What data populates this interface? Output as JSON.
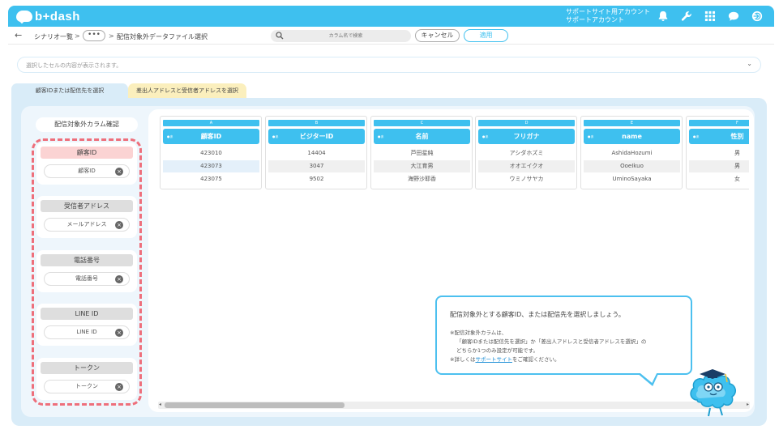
{
  "header": {
    "logo_text": "b+dash",
    "account_line1": "サポートサイト用アカウント",
    "account_line2": "サポートアカウント",
    "icons": [
      "bell-icon",
      "wrench-icon",
      "grid-icon",
      "chat-icon",
      "logout-icon"
    ],
    "bg_color": "#3ec0ef"
  },
  "breadcrumb": {
    "back": "←",
    "item1": "シナリオ一覧",
    "sep": ">",
    "more": "•••",
    "item2": "配信対象外データファイル選択"
  },
  "toolbar": {
    "search_placeholder": "カラム名で検索",
    "cancel_label": "キャンセル",
    "apply_label": "適用"
  },
  "cell_bar": {
    "placeholder": "選択したセルの内容が表示されます。"
  },
  "tabs": [
    {
      "label": "顧客IDまたは配信先を選択",
      "active": true
    },
    {
      "label": "差出人アドレスと受信者アドレスを選択",
      "active": false
    }
  ],
  "left_panel": {
    "title": "配信対象外カラム確認",
    "cards": [
      {
        "label": "顧客ID",
        "chip": "顧客ID"
      },
      {
        "label": "受信者アドレス",
        "chip": "メールアドレス"
      },
      {
        "label": "電話番号",
        "chip": "電話番号"
      },
      {
        "label": "LINE ID",
        "chip": "LINE ID"
      },
      {
        "label": "トークン",
        "chip": "トークン"
      }
    ]
  },
  "columns": [
    {
      "letter": "A",
      "tag": "●あ",
      "header": "顧客ID",
      "cells": [
        "423010",
        "423073",
        "423075"
      ]
    },
    {
      "letter": "B",
      "tag": "●あ",
      "header": "ビジターID",
      "cells": [
        "14404",
        "3047",
        "9502"
      ]
    },
    {
      "letter": "C",
      "tag": "●あ",
      "header": "名前",
      "cells": [
        "芦田星純",
        "大江育男",
        "海野沙耶香"
      ]
    },
    {
      "letter": "D",
      "tag": "●あ",
      "header": "フリガナ",
      "cells": [
        "アシダホズミ",
        "オオエイクオ",
        "ウミノサヤカ"
      ]
    },
    {
      "letter": "E",
      "tag": "●あ",
      "header": "name",
      "cells": [
        "AshidaHozumi",
        "OoeIkuo",
        "UminoSayaka"
      ]
    },
    {
      "letter": "F",
      "tag": "●あ",
      "header": "性別",
      "cells": [
        "男",
        "男",
        "女"
      ]
    }
  ],
  "balloon": {
    "main": "配信対象外とする顧客ID、または配信先を選択しましょう。",
    "line1": "※配信対象外カラムは、",
    "line2": "「顧客IDまたは配信先を選択」か「差出人アドレスと受信者アドレスを選択」の",
    "line3": "どちらか1つのみ設定が可能です。",
    "line4_pre": "※詳しくは",
    "line4_link": "サポートサイト",
    "line4_post": "をご確認ください。"
  },
  "colors": {
    "accent": "#3ec0ef",
    "dash_border": "#ee6f7b",
    "panel_bg": "#d9ecf8",
    "tab2_bg": "#fbefbd",
    "pink_label": "#fbd3d3"
  }
}
